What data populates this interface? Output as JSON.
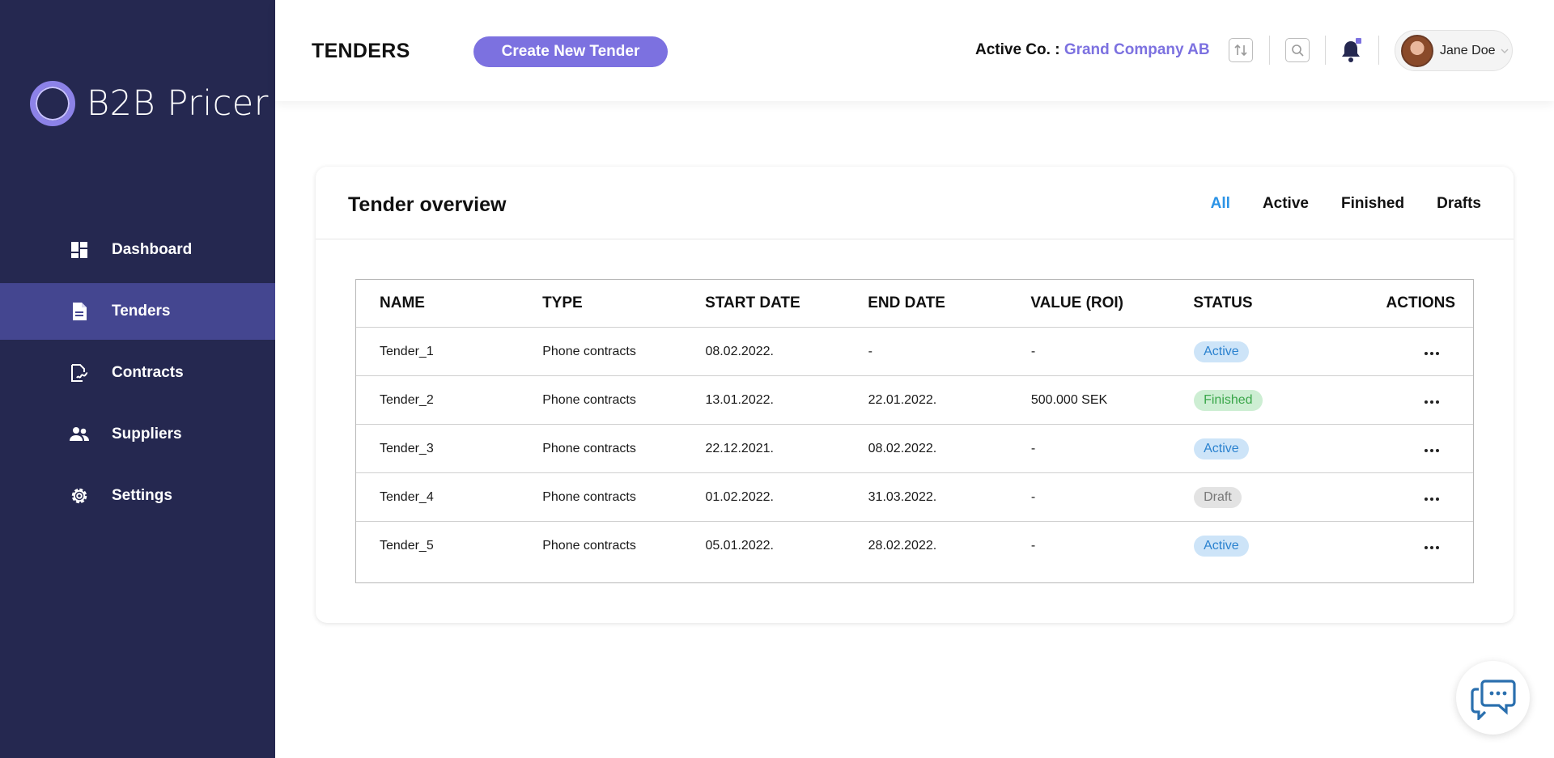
{
  "sidebar": {
    "logo_text": "B2B Pricer",
    "items": [
      {
        "label": "Dashboard",
        "icon": "dashboard-icon"
      },
      {
        "label": "Tenders",
        "icon": "document-icon",
        "active": true
      },
      {
        "label": "Contracts",
        "icon": "contract-signature-icon"
      },
      {
        "label": "Suppliers",
        "icon": "people-icon"
      },
      {
        "label": "Settings",
        "icon": "gear-icon"
      }
    ]
  },
  "header": {
    "title": "TENDERS",
    "create_button": "Create New Tender",
    "active_co_label": "Active Co. :",
    "active_co_name": "Grand Company AB",
    "user_name": "Jane Doe",
    "notification_count": "1"
  },
  "overview": {
    "title": "Tender overview",
    "filters": [
      "All",
      "Active",
      "Finished",
      "Drafts"
    ],
    "active_filter": "All",
    "columns": [
      "NAME",
      "TYPE",
      "START DATE",
      "END DATE",
      "VALUE (ROI)",
      "STATUS",
      "ACTIONS"
    ],
    "rows": [
      {
        "name": "Tender_1",
        "type": "Phone contracts",
        "start": "08.02.2022.",
        "end": "-",
        "value": "-",
        "status": "Active"
      },
      {
        "name": "Tender_2",
        "type": "Phone contracts",
        "start": "13.01.2022.",
        "end": "22.01.2022.",
        "value": "500.000 SEK",
        "status": "Finished"
      },
      {
        "name": "Tender_3",
        "type": "Phone contracts",
        "start": "22.12.2021.",
        "end": "08.02.2022.",
        "value": "-",
        "status": "Active"
      },
      {
        "name": "Tender_4",
        "type": "Phone contracts",
        "start": "01.02.2022.",
        "end": "31.03.2022.",
        "value": "-",
        "status": "Draft"
      },
      {
        "name": "Tender_5",
        "type": "Phone contracts",
        "start": "05.01.2022.",
        "end": "28.02.2022.",
        "value": "-",
        "status": "Active"
      }
    ]
  },
  "colors": {
    "sidebar_bg": "#252850",
    "sidebar_active": "#444690",
    "accent": "#7c71e0",
    "filter_active": "#2b93e6"
  }
}
